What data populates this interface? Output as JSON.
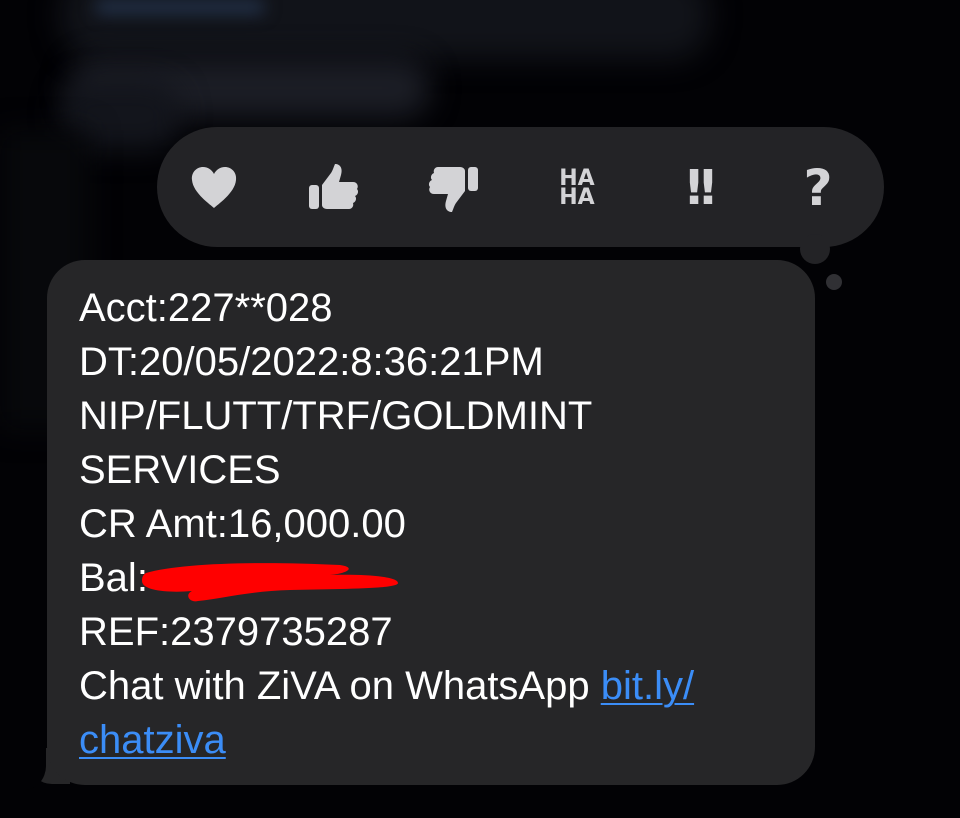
{
  "colors": {
    "bubble": "#262628",
    "tapback": "#232326",
    "text": "#ffffff",
    "link": "#3b8df7",
    "redaction": "#ff0000",
    "icon": "#d3d3d6"
  },
  "tapbacks": [
    {
      "icon": "heart-icon"
    },
    {
      "icon": "thumbs-up-icon"
    },
    {
      "icon": "thumbs-down-icon"
    },
    {
      "icon": "haha-icon",
      "line1": "HA",
      "line2": "HA"
    },
    {
      "icon": "exclamation-icon",
      "label": "!!"
    },
    {
      "icon": "question-icon",
      "label": "?"
    }
  ],
  "message": {
    "acct": "Acct:227**028",
    "dt": "DT:20/05/2022:8:36:21PM",
    "narration1": "NIP/FLUTT/TRF/GOLDMINT",
    "narration2": "SERVICES",
    "cr_amt": "CR Amt:16,000.00",
    "bal": "Bal:",
    "ref": "REF:2379735287",
    "chat_text": "Chat with ZiVA on WhatsApp ",
    "link_part1": "bit.ly/",
    "link_part2": "chatziva"
  }
}
